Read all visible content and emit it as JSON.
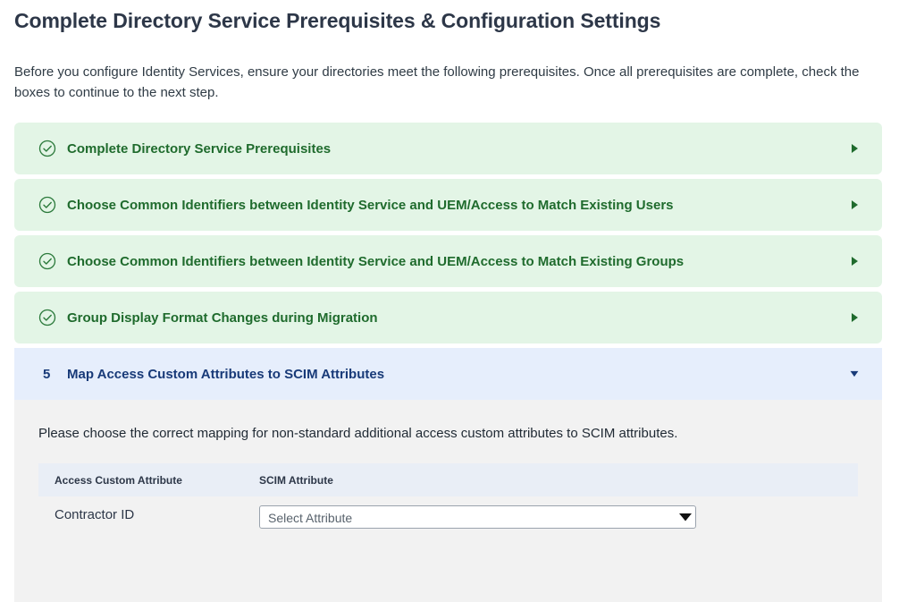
{
  "page": {
    "title": "Complete Directory Service Prerequisites & Configuration Settings",
    "intro": "Before you configure Identity Services, ensure your directories meet the following prerequisites. Once all prerequisites are complete, check the boxes to continue to the next step."
  },
  "steps": [
    {
      "label": "Complete Directory Service Prerequisites",
      "status": "completed",
      "icon": "check-circle-icon"
    },
    {
      "label": "Choose Common Identifiers between Identity Service and UEM/Access to Match Existing Users",
      "status": "completed",
      "icon": "check-circle-icon"
    },
    {
      "label": "Choose Common Identifiers between Identity Service and UEM/Access to Match Existing Groups",
      "status": "completed",
      "icon": "check-circle-icon"
    },
    {
      "label": "Group Display Format Changes during Migration",
      "status": "completed",
      "icon": "check-circle-icon"
    },
    {
      "number": "5",
      "label": "Map Access Custom Attributes to SCIM Attributes",
      "status": "expanded"
    }
  ],
  "panel": {
    "description": "Please choose the correct mapping for non-standard additional access custom attributes to SCIM attributes.",
    "table": {
      "headers": [
        "Access Custom Attribute",
        "SCIM Attribute"
      ],
      "rows": [
        {
          "attribute": "Contractor ID",
          "select_value": "Select Attribute"
        }
      ]
    }
  },
  "colors": {
    "completed_bg": "#e3f5e6",
    "completed_text": "#1f6b2d",
    "active_bg": "#e6eefc",
    "active_text": "#183a78",
    "panel_bg": "#f2f2f2"
  }
}
